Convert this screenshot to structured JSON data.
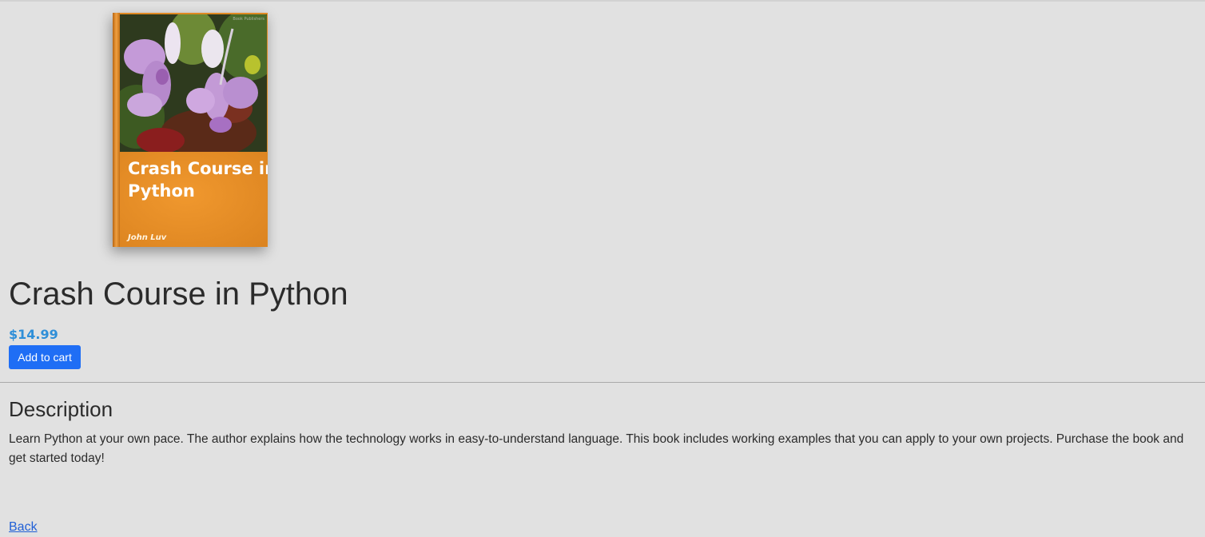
{
  "book": {
    "cover": {
      "title_line1": "Crash Course in",
      "title_line2": "Python",
      "author": "John Luv",
      "publisher": "Book Publishers"
    },
    "title": "Crash Course in Python",
    "price": "$14.99",
    "add_to_cart_label": "Add to cart"
  },
  "description": {
    "heading": "Description",
    "text": "Learn Python at your own pace. The author explains how the technology works in easy-to-understand language. This book includes working examples that you can apply to your own projects. Purchase the book and get started today!"
  },
  "navigation": {
    "back_label": "Back"
  },
  "colors": {
    "background": "#e1e1e1",
    "price": "#2f8fd8",
    "button": "#1f6ef5",
    "link": "#1f5fd6",
    "cover_orange": "#e8922a"
  }
}
